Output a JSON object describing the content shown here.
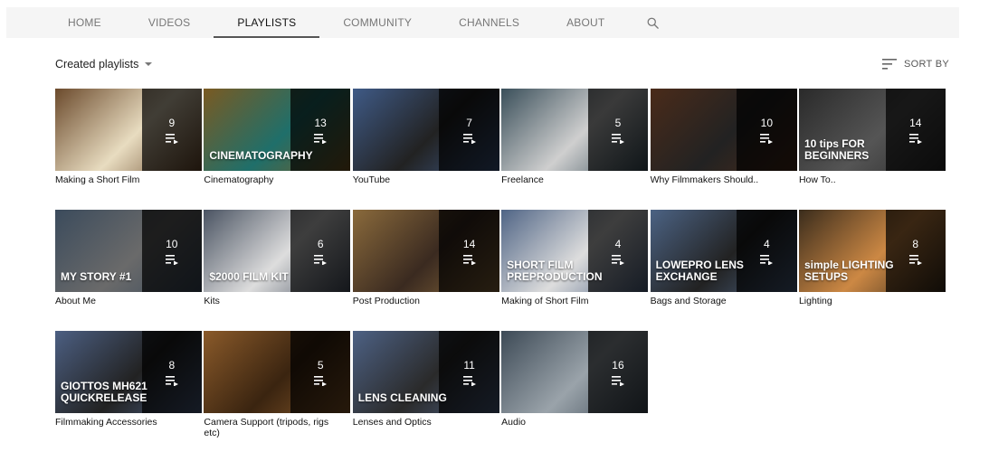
{
  "tabs": [
    {
      "label": "HOME",
      "active": false
    },
    {
      "label": "VIDEOS",
      "active": false
    },
    {
      "label": "PLAYLISTS",
      "active": true
    },
    {
      "label": "COMMUNITY",
      "active": false
    },
    {
      "label": "CHANNELS",
      "active": false
    },
    {
      "label": "ABOUT",
      "active": false
    }
  ],
  "toolbar": {
    "created_label": "Created playlists",
    "sort_label": "SORT BY"
  },
  "playlists": [
    {
      "title": "Making a Short Film",
      "count": "9",
      "bg": "#6b4a2c",
      "accent": "#e8dcc0",
      "thumb_text": ""
    },
    {
      "title": "Cinematography",
      "count": "13",
      "bg": "#7a5a22",
      "accent": "#1f6f6a",
      "thumb_text": "CINEMATOGRAPHY"
    },
    {
      "title": "YouTube",
      "count": "7",
      "bg": "#3f5a86",
      "accent": "#222",
      "thumb_text": ""
    },
    {
      "title": "Freelance",
      "count": "5",
      "bg": "#3a4f5a",
      "accent": "#cfcfcf",
      "thumb_text": ""
    },
    {
      "title": "Why Filmmakers Should..",
      "count": "10",
      "bg": "#4a2b1a",
      "accent": "#222",
      "thumb_text": ""
    },
    {
      "title": "How To..",
      "count": "14",
      "bg": "#2a2a2a",
      "accent": "#555",
      "thumb_text": "10 tips FOR BEGINNERS"
    },
    {
      "title": "About Me",
      "count": "10",
      "bg": "#3b4b5c",
      "accent": "#6a6a6a",
      "thumb_text": "MY STORY #1"
    },
    {
      "title": "Kits",
      "count": "6",
      "bg": "#4a5362",
      "accent": "#ddd",
      "thumb_text": "$2000 FILM KIT"
    },
    {
      "title": "Post Production",
      "count": "14",
      "bg": "#8a6a3c",
      "accent": "#3a2a20",
      "thumb_text": ""
    },
    {
      "title": "Making of Short Film",
      "count": "4",
      "bg": "#4f6485",
      "accent": "#ddd",
      "thumb_text": "SHORT FILM PREPRODUCTION"
    },
    {
      "title": "Bags and Storage",
      "count": "4",
      "bg": "#4c6384",
      "accent": "#222",
      "thumb_text": "LOWEPRO LENS EXCHANGE"
    },
    {
      "title": "Lighting",
      "count": "8",
      "bg": "#3a2c1c",
      "accent": "#cc8844",
      "thumb_text": "simple LIGHTING SETUPS"
    },
    {
      "title": "Filmmaking Accessories",
      "count": "8",
      "bg": "#4c5f82",
      "accent": "#222",
      "thumb_text": "GIOTTOS MH621 QUICKRELEASE"
    },
    {
      "title": "Camera Support (tripods, rigs etc)",
      "count": "5",
      "bg": "#8a5a2a",
      "accent": "#3a2410",
      "thumb_text": ""
    },
    {
      "title": "Lenses and Optics",
      "count": "11",
      "bg": "#4d6184",
      "accent": "#2a2a2a",
      "thumb_text": "LENS CLEANING"
    },
    {
      "title": "Audio",
      "count": "16",
      "bg": "#3d4a56",
      "accent": "#9aa3aa",
      "thumb_text": ""
    }
  ]
}
